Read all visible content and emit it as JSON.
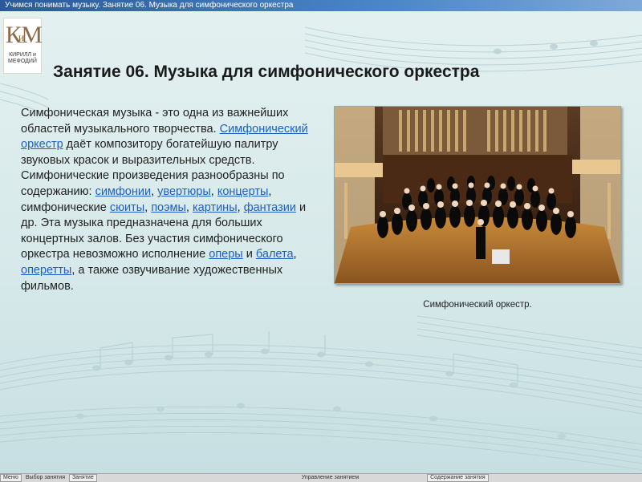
{
  "window": {
    "title": "Учимся понимать музыку. Занятие 06. Музыка для симфонического оркестра"
  },
  "logo": {
    "monogram_big": "К",
    "monogram_small": "и",
    "monogram_m": "М",
    "name_line1": "КИРИЛЛ и",
    "name_line2": "МЕФОДИЙ"
  },
  "lesson": {
    "heading": "Занятие 06. Музыка для симфонического оркестра",
    "p1": "Симфоническая музыка - это одна из важнейших областей музыкального творчества. ",
    "link_orchestra": "Симфонический оркестр",
    "p2": " даёт композитору богатейшую палитру звуковых красок и выразительных средств. Симфонические произведения разнообразны по содержанию: ",
    "link_symphonies": "симфонии",
    "sep1": ", ",
    "link_overtures": "увертюры",
    "sep2": ", ",
    "link_concertos": "концерты",
    "p3": ", симфонические ",
    "link_suites": "сюиты",
    "sep3": ", ",
    "link_poems": "поэмы",
    "sep4": ", ",
    "link_pictures": "картины",
    "sep5": ", ",
    "link_fantasies": "фантазии",
    "p4": " и др. Эта музыка предназначена для больших концертных залов. Без участия симфонического оркестра невозможно исполнение ",
    "link_operas": "оперы",
    "p5": " и ",
    "link_ballets": "балета",
    "sep6": ", ",
    "link_operettas": "оперетты",
    "p6": ", а также озвучивание художественных фильмов."
  },
  "photo": {
    "caption": "Симфонический оркестр."
  },
  "statusbar": {
    "menu": "Меню",
    "lesson_select": "Выбор занятия",
    "lesson": "Занятие",
    "management": "Управление занятием",
    "content": "Содержание занятия"
  }
}
